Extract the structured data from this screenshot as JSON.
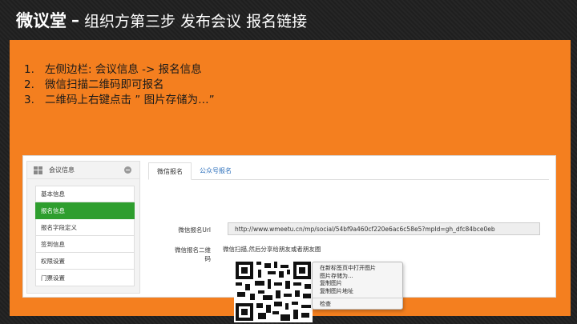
{
  "title": {
    "brand": "微议堂",
    "separator": "–",
    "subtitle": "组织方第三步 发布会议 报名链接"
  },
  "steps": [
    {
      "num": "1.",
      "text": "左侧边栏: 会议信息 -> 报名信息"
    },
    {
      "num": "2.",
      "text": "微信扫描二维码即可报名"
    },
    {
      "num": "3.",
      "text": "二维码上右键点击 ” 图片存储为…”"
    }
  ],
  "sidebar": {
    "header": "会议信息",
    "items": [
      {
        "label": "基本信息",
        "active": false
      },
      {
        "label": "报名信息",
        "active": true
      },
      {
        "label": "报名字段定义",
        "active": false
      },
      {
        "label": "签到信息",
        "active": false
      },
      {
        "label": "权限设置",
        "active": false
      },
      {
        "label": "门票设置",
        "active": false
      }
    ]
  },
  "tabs": [
    {
      "label": "微信报名",
      "active": true
    },
    {
      "label": "公众号报名",
      "active": false
    }
  ],
  "form": {
    "url_label": "微信报名Url",
    "url_value": "http://www.wmeetu.cn/mp/social/54bf9a460cf220e6ac6c58e5?mpId=gh_dfc84bce0eb",
    "qr_label_line1": "微信报名二维",
    "qr_label_line2": "码",
    "qr_hint": "微信扫描,然后分享给朋友或者朋友圈"
  },
  "context_menu": {
    "items": [
      "在新标签页中打开图片",
      "图片存储为...",
      "复制图片",
      "复制图片地址"
    ],
    "inspect": "检查"
  },
  "colors": {
    "accent": "#f47f1f",
    "active_green": "#2e9e2e",
    "link_blue": "#2a6ebb"
  }
}
